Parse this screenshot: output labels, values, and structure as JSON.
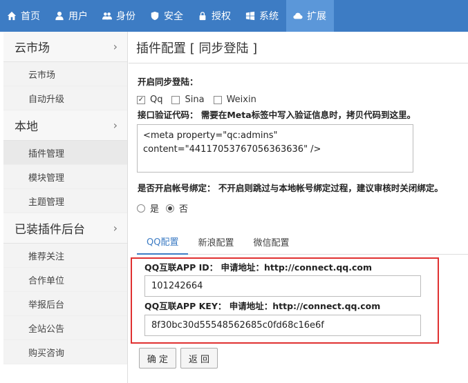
{
  "nav": [
    {
      "label": "首页",
      "icon": "home-icon"
    },
    {
      "label": "用户",
      "icon": "user-icon"
    },
    {
      "label": "身份",
      "icon": "users-icon"
    },
    {
      "label": "安全",
      "icon": "shield-icon"
    },
    {
      "label": "授权",
      "icon": "lock-icon"
    },
    {
      "label": "系统",
      "icon": "windows-icon"
    },
    {
      "label": "扩展",
      "icon": "cloud-icon"
    }
  ],
  "sidebar": {
    "groups": [
      {
        "title": "云市场",
        "items": [
          "云市场",
          "自动升级"
        ]
      },
      {
        "title": "本地",
        "items": [
          "插件管理",
          "模块管理",
          "主题管理"
        ]
      },
      {
        "title": "已装插件后台",
        "items": [
          "推荐关注",
          "合作单位",
          "举报后台",
          "全站公告",
          "购买咨询"
        ]
      }
    ]
  },
  "page": {
    "title": "插件配置 [ 同步登陆 ]",
    "enable_label": "开启同步登陆：",
    "options": [
      "Qq",
      "Sina",
      "Weixin"
    ],
    "verify_label": "接口验证代码：  需要在Meta标签中写入验证信息时，拷贝代码到这里。",
    "meta_code": "<meta property=\"qc:admins\" content=\"44117053767056363636\" />",
    "bind_label": "是否开启帐号绑定：  不开启则跳过与本地帐号绑定过程，建议审核时关闭绑定。",
    "radio_yes": "是",
    "radio_no": "否",
    "tabs": [
      "QQ配置",
      "新浪配置",
      "微信配置"
    ],
    "appid_label": "QQ互联APP ID：  申请地址：http://connect.qq.com",
    "appid_value": "101242664",
    "appkey_label": "QQ互联APP KEY：  申请地址：http://connect.qq.com",
    "appkey_value": "8f30bc30d55548562685c0fd68c16e6f",
    "btn_ok": "确 定",
    "btn_back": "返 回"
  }
}
